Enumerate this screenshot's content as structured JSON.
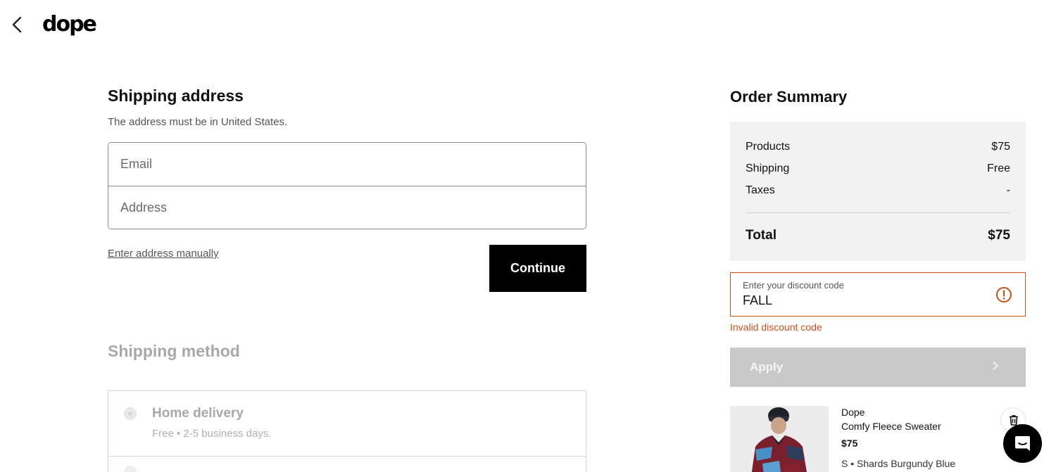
{
  "header": {
    "logo": "dope"
  },
  "shipping": {
    "title": "Shipping address",
    "note": "The address must be in United States.",
    "email_placeholder": "Email",
    "address_placeholder": "Address",
    "manual_link": "Enter address manually",
    "continue_label": "Continue"
  },
  "shipping_method": {
    "title": "Shipping method",
    "options": [
      {
        "label": "Home delivery",
        "detail": "Free • 2-5 business days."
      }
    ]
  },
  "order_summary": {
    "title": "Order Summary",
    "rows": [
      {
        "label": "Products",
        "value": "$75"
      },
      {
        "label": "Shipping",
        "value": "Free"
      },
      {
        "label": "Taxes",
        "value": "-"
      }
    ],
    "total_label": "Total",
    "total_value": "$75"
  },
  "discount": {
    "label": "Enter your discount code",
    "value": "FALL",
    "error": "Invalid discount code",
    "apply_label": "Apply",
    "error_color": "#c8501a"
  },
  "cart": {
    "items": [
      {
        "brand": "Dope",
        "name": "Comfy Fleece Sweater",
        "price": "$75",
        "variant": "S • Shards Burgundy Blue"
      }
    ]
  },
  "icons": [
    "chevron-left-icon",
    "warning-circle-icon",
    "chevron-right-icon",
    "trash-icon",
    "chat-icon"
  ]
}
